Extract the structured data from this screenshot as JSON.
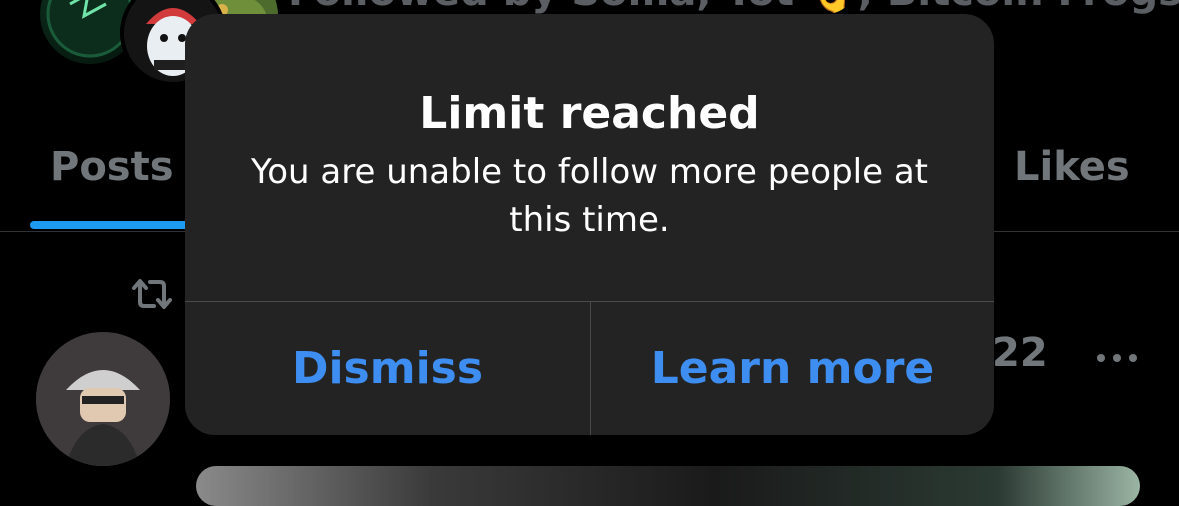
{
  "profile": {
    "followed_by_text": "Followed by Soma, Tot 👌, Bitcoin Frogs,"
  },
  "tabs": [
    {
      "label": "Posts"
    },
    {
      "label": "Likes"
    }
  ],
  "post": {
    "time_partial": "22"
  },
  "alert": {
    "title": "Limit reached",
    "message": "You are unable to follow more people at this time.",
    "dismiss_label": "Dismiss",
    "learn_more_label": "Learn more"
  },
  "colors": {
    "accent": "#3d8ef0",
    "tab_underline": "#1d9bf0",
    "alert_bg": "#232323",
    "background": "#000000"
  }
}
